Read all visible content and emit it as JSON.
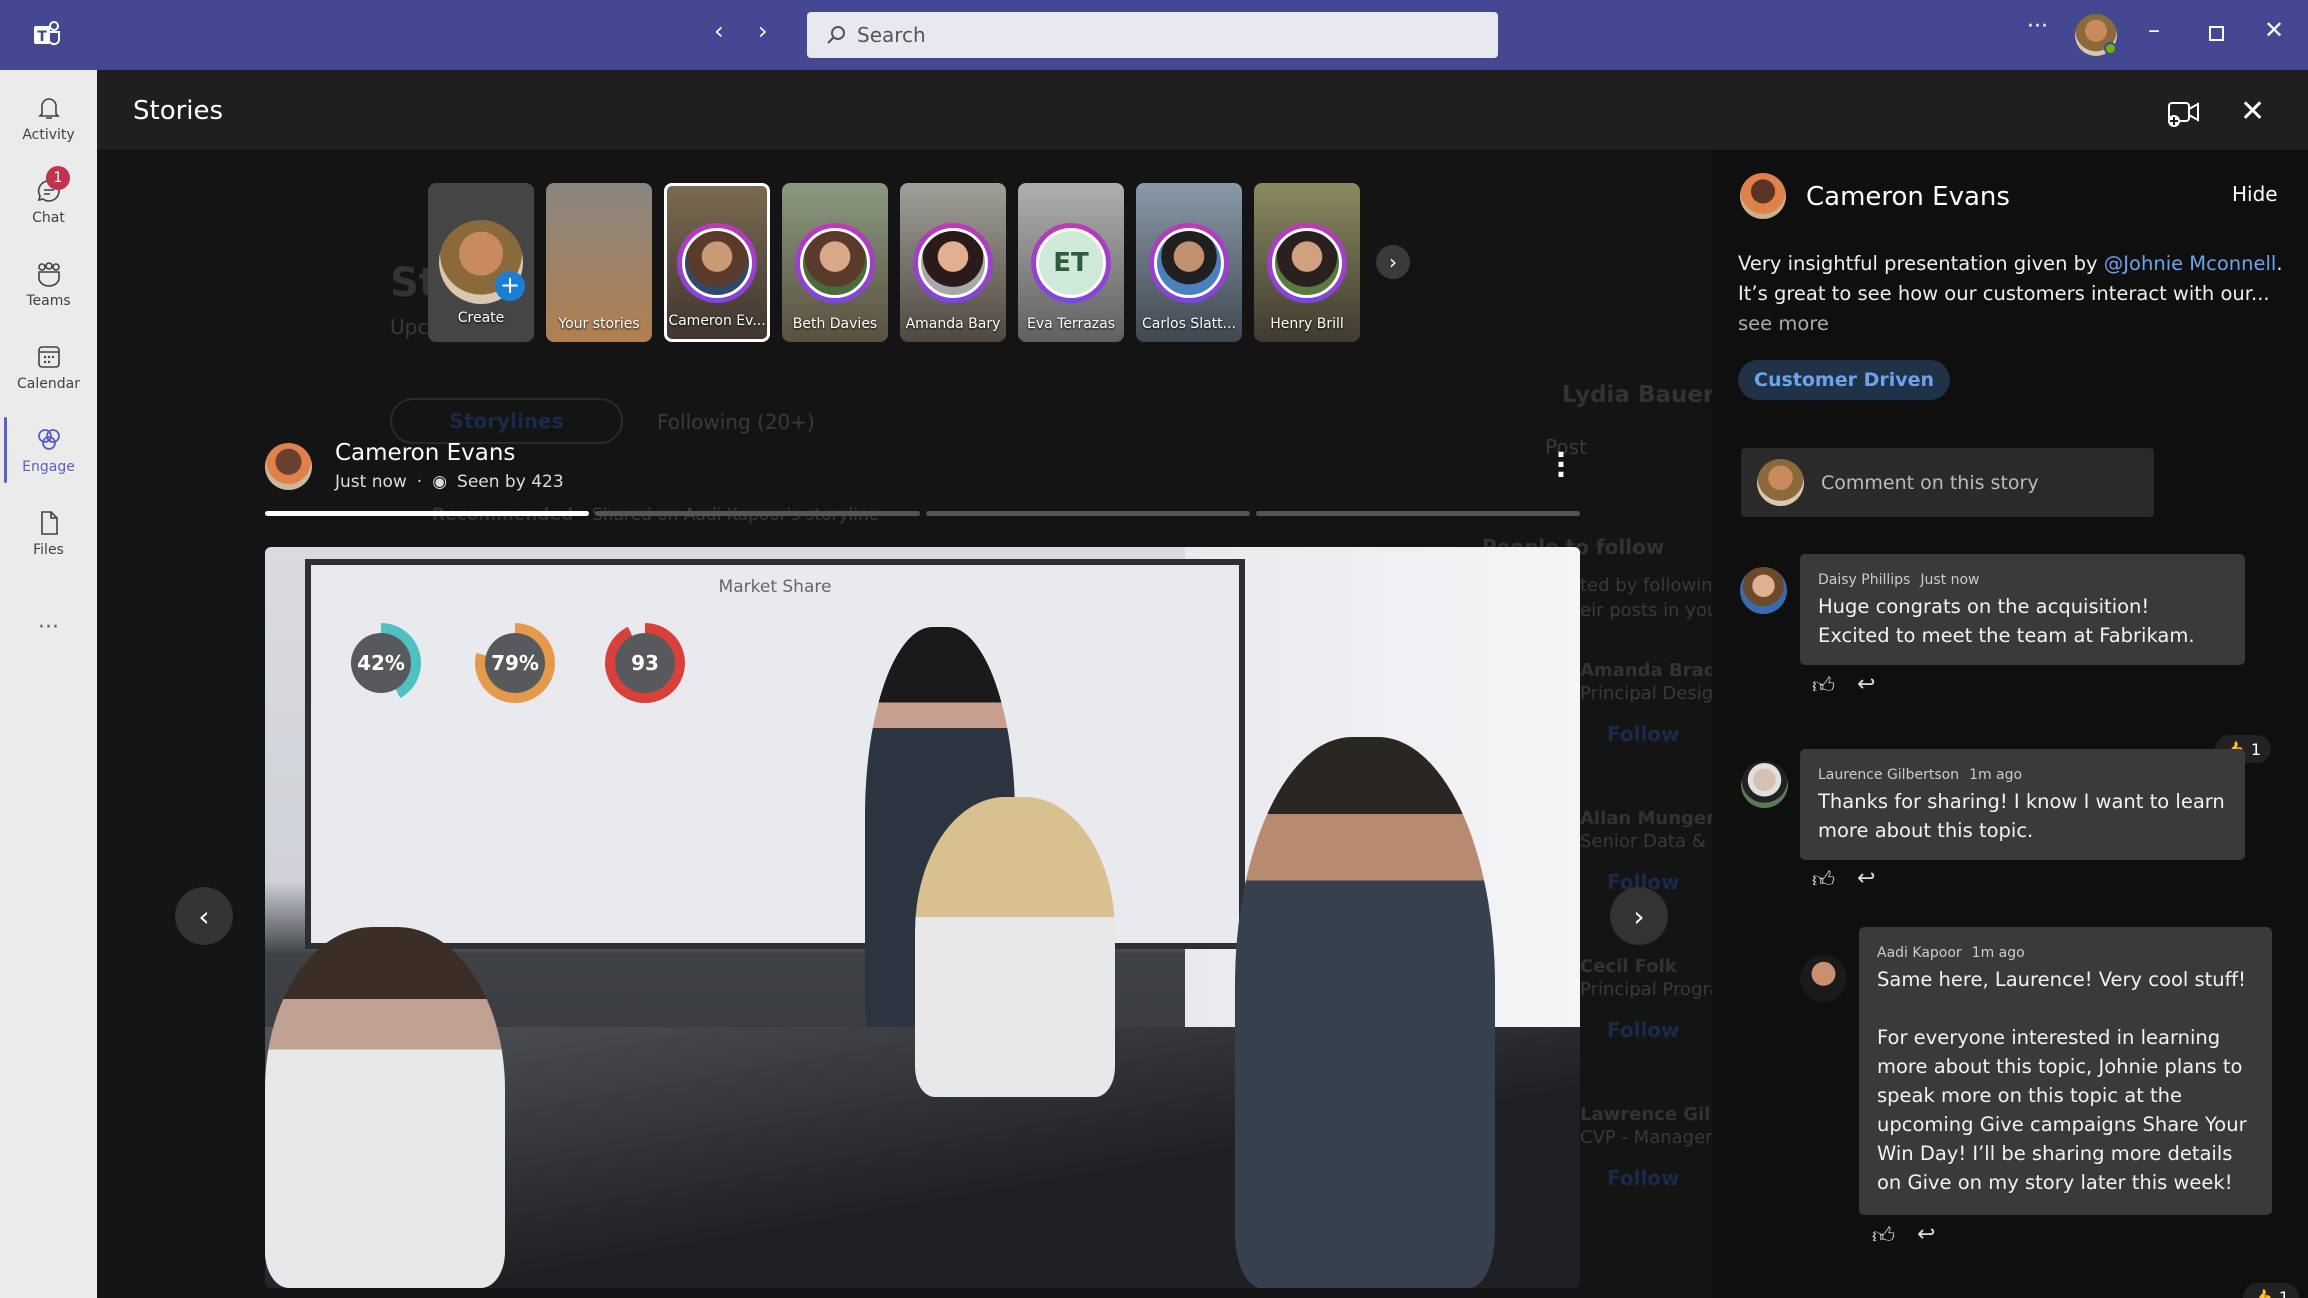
{
  "titlebar": {
    "search_placeholder": "Search",
    "more": "···"
  },
  "rail": {
    "items": [
      {
        "label": "Activity"
      },
      {
        "label": "Chat",
        "badge": "1"
      },
      {
        "label": "Teams"
      },
      {
        "label": "Calendar"
      },
      {
        "label": "Engage",
        "selected": true
      },
      {
        "label": "Files"
      }
    ],
    "more": "···"
  },
  "header": {
    "title": "Stories"
  },
  "background_page": {
    "title_partial": "St",
    "subtitle_partial": "Upc",
    "tabs": [
      "Storylines",
      "Following (20+)"
    ],
    "recommended": "Recommended",
    "shared": "Shared on Aadi Kapoor's storyline",
    "profile_name": "Lydia Bauer",
    "post": "Post",
    "people_to_follow": "People to follow",
    "follow_desc": [
      "ted by following",
      "eir posts in your f"
    ],
    "people": [
      {
        "name": "Amanda Brady",
        "title": "Principal Design R"
      },
      {
        "name": "Allan Munger",
        "title": "Senior Data & Ap"
      },
      {
        "name": "Cecil Folk",
        "title": "Principal Program"
      },
      {
        "name": "Lawrence Gilberts",
        "title": "CVP - Manager"
      }
    ],
    "follow_label": "Follow"
  },
  "story_strip": [
    {
      "label": "Create",
      "type": "create"
    },
    {
      "label": "Your stories",
      "type": "own"
    },
    {
      "label": "Cameron Ev...",
      "selected": true
    },
    {
      "label": "Beth Davies"
    },
    {
      "label": "Amanda Bary"
    },
    {
      "label": "Eva Terrazas",
      "initials": "ET"
    },
    {
      "label": "Carlos Slatt..."
    },
    {
      "label": "Henry Brill"
    }
  ],
  "story": {
    "author": "Cameron Evans",
    "time": "Just now",
    "seen": "Seen by 423",
    "progress_segments": 4,
    "current_segment": 1,
    "current_progress": 1.0,
    "slide": {
      "title": "Market Share",
      "values": [
        "42%",
        "79%",
        "93"
      ],
      "colors": [
        "#4fc1c0",
        "#e49a4a",
        "#d9403a"
      ]
    }
  },
  "panel": {
    "author": "Cameron Evans",
    "hide": "Hide",
    "desc_1": "Very insightful presentation given by ",
    "mention": "@Johnie Mconnell",
    "desc_2": ". It’s great to see how our customers interact with our... ",
    "see_more": "see more",
    "tag": "Customer Driven",
    "comment_placeholder": "Comment on this story",
    "comments": [
      {
        "name": "Daisy Phillips",
        "time": "Just now",
        "text": "Huge congrats on the acquisition! Excited to meet the team at Fabrikam."
      },
      {
        "name": "Laurence Gilbertson",
        "time": "1m ago",
        "text": "Thanks for sharing! I know I want to learn more about this topic.",
        "reactions": "1"
      },
      {
        "name": "Aadi Kapoor",
        "time": "1m ago",
        "text": "Same here, Laurence! Very cool stuff!",
        "text2": "For everyone interested in learning more about this topic, Johnie plans to speak more on this topic at the upcoming Give campaigns Share Your Win Day! I’ll be sharing more details on Give on my story later this week!",
        "reactions": "1"
      }
    ]
  },
  "colors": {
    "titlebar": "#444791",
    "accent": "#5b5fc7",
    "mention": "#6ca4ec",
    "badge": "#c4314b"
  }
}
